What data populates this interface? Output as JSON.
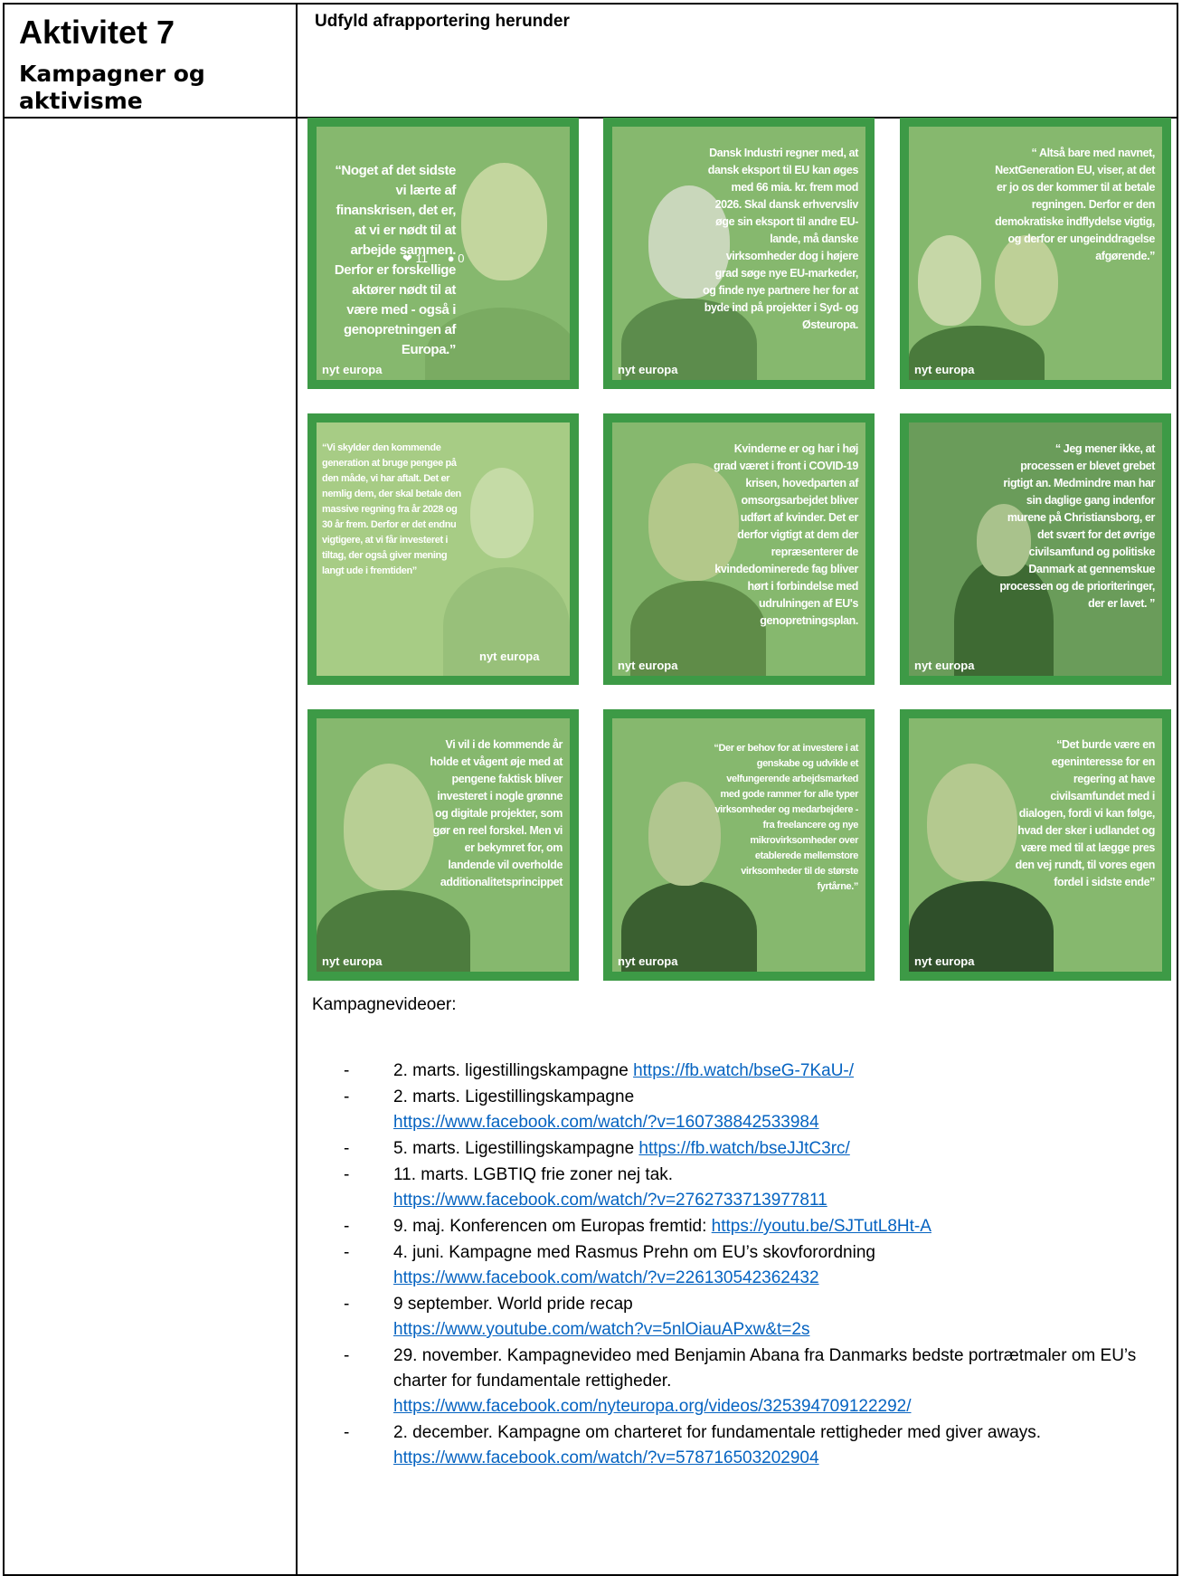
{
  "header": {
    "activity_title": "Aktivitet 7",
    "activity_subtitle": "Kampagner og aktivisme",
    "instruction": "Udfyld afrapportering herunder"
  },
  "cards": [
    {
      "quote": "“Noget af det sidste vi lærte af finanskrisen, det er, at vi er nødt til at arbejde sammen. Derfor er forskellige aktører nødt til at være med - også i genopretningen af Europa.”",
      "overlay_likes": "11",
      "overlay_comments": "0",
      "logo": "nyt europa"
    },
    {
      "quote": "Dansk Industri regner med, at dansk eksport til EU kan øges med 66 mia. kr. frem mod 2026. Skal dansk erhvervsliv øge sin eksport til andre EU-lande, må danske virksomheder dog i højere grad søge nye EU-markeder, og finde nye partnere her for at byde ind på projekter i Syd- og Østeuropa.",
      "logo": "nyt europa"
    },
    {
      "quote": "“ Altså bare med navnet, NextGeneration EU, viser, at det er jo os der kommer til at betale regningen. Derfor er den demokratiske indflydelse vigtig, og derfor er ungeinddragelse afgørende.”",
      "logo": "nyt europa"
    },
    {
      "quote": "“Vi skylder den kommende generation at bruge pengee på den måde, vi har aftalt. Det er nemlig dem, der skal betale den massive regning fra år 2028 og 30 år frem. Derfor er det endnu vigtigere, at vi får investeret i tiltag, der også giver mening langt ude i fremtiden”",
      "logo": "nyt europa"
    },
    {
      "quote": "Kvinderne er og har i høj grad været i front i COVID-19 krisen, hovedparten af omsorgsarbejdet bliver udført af kvinder. Det er derfor vigtigt at dem der repræsenterer de kvindedominerede fag bliver hørt i forbindelse med udrulningen af EU's genopretningsplan.",
      "logo": "nyt europa"
    },
    {
      "quote": "“ Jeg mener ikke, at processen er blevet grebet rigtigt an. Medmindre man har sin daglige gang indenfor murene på Christiansborg, er det svært for det øvrige civilsamfund og politiske Danmark at gennemskue processen og de prioriteringer, der er lavet. ”",
      "logo": "nyt europa"
    },
    {
      "quote": "Vi vil i de kommende år holde et vågent øje med at pengene faktisk bliver investeret i nogle grønne og digitale projekter, som gør en reel forskel. Men vi er bekymret for, om landende vil overholde additionalitetsprincippet",
      "logo": "nyt europa"
    },
    {
      "quote": "“Der er behov for at investere i at genskabe og udvikle et velfungerende arbejdsmarked med gode rammer for alle typer virksomheder og medarbejdere - fra freelancere og nye mikrovirksomheder over etablerede mellemstore virksomheder til de største fyrtårne.”",
      "logo": "nyt europa"
    },
    {
      "quote": "“Det burde være en egeninteresse for en regering at have civilsamfundet med i dialogen, fordi vi kan følge, hvad der sker i udlandet og være med til at lægge pres den vej rundt, til vores egen fordel i sidste ende”",
      "logo": "nyt europa"
    }
  ],
  "videos_label": "Kampagnevideoer:",
  "videos": [
    {
      "text": "2. marts. ligestillingskampagne ",
      "url": "https://fb.watch/bseG-7KaU-/"
    },
    {
      "text": "2. marts. Ligestillingskampagne",
      "url": "https://www.facebook.com/watch/?v=160738842533984"
    },
    {
      "text": "5. marts. Ligestillingskampagne ",
      "url": "https://fb.watch/bseJJtC3rc/"
    },
    {
      "text": "11. marts. LGBTIQ frie zoner nej tak.",
      "url": "https://www.facebook.com/watch/?v=2762733713977811"
    },
    {
      "text": "9. maj. Konferencen om Europas fremtid: ",
      "url": "https://youtu.be/SJTutL8Ht-A"
    },
    {
      "text": "4. juni. Kampagne med Rasmus Prehn om EU’s skovforordning",
      "url": "https://www.facebook.com/watch/?v=226130542362432"
    },
    {
      "text": "9 september. World pride recap",
      "url": "https://www.youtube.com/watch?v=5nlOiauAPxw&t=2s"
    },
    {
      "text": "29. november. Kampagnevideo med Benjamin Abana fra Danmarks bedste portrætmaler om EU’s charter for fundamentale rettigheder.",
      "url": "https://www.facebook.com/nyteuropa.org/videos/325394709122292/"
    },
    {
      "text": "2. december. Kampagne om charteret for fundamentale rettigheder med giver aways.",
      "url": "https://www.facebook.com/watch/?v=578716503202904"
    }
  ]
}
